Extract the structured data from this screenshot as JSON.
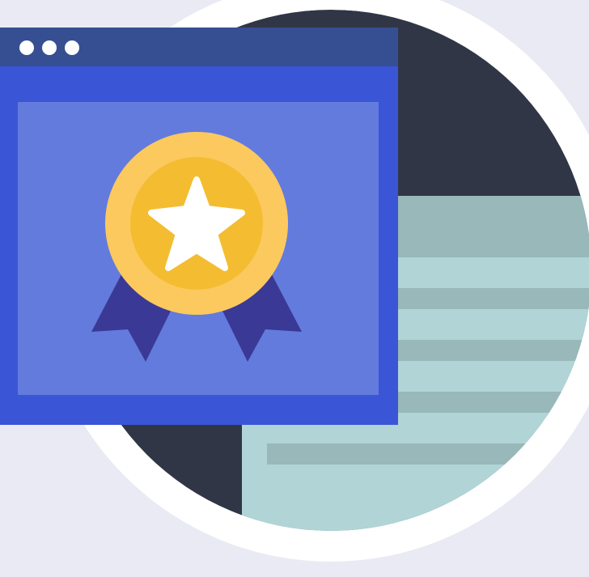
{
  "illustration": {
    "subject": "certificate-award",
    "icons": [
      "browser-window-icon",
      "award-medal-icon",
      "star-icon",
      "ribbon-icon",
      "document-icon"
    ],
    "colors": {
      "background_panel": "#E9EAF3",
      "white_ring": "#FFFFFF",
      "dark_circle": "#313646",
      "document_light": "#B1D4D6",
      "document_line": "#98B8B9",
      "window_frame": "#3A55D5",
      "window_titlebar": "#354F92",
      "window_panel": "#637BDC",
      "window_dots": "#FFFFFF",
      "medal_outer": "#FCC95E",
      "medal_inner": "#F4BC31",
      "star": "#FFFFFF",
      "ribbon": "#3B3996"
    },
    "window_control_dots": 3,
    "document_text_lines": 5
  }
}
